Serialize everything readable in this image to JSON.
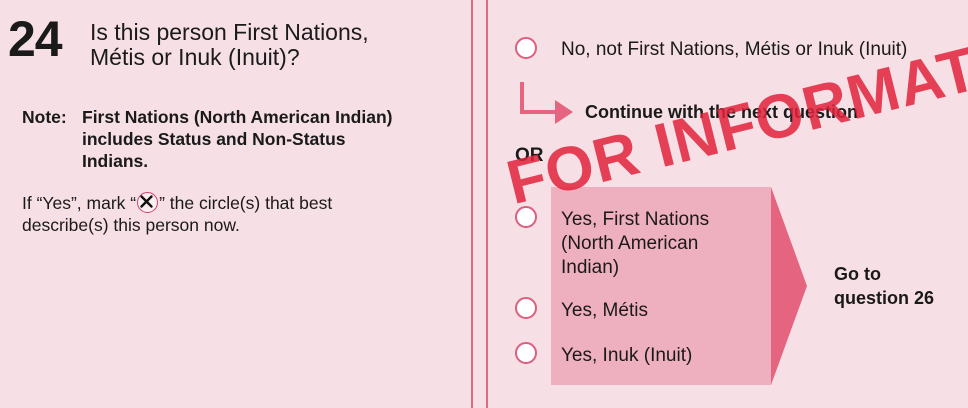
{
  "question": {
    "number": "24",
    "text": "Is this person First Nations,\nMétis or Inuk (Inuit)?",
    "note_label": "Note:",
    "note_text": "First Nations (North American Indian)\nincludes Status and Non-Status\nIndians.",
    "instruction_before": "If “Yes”, mark “",
    "instruction_after": "” the circle(s) that best",
    "instruction_line2": "describe(s) this person now."
  },
  "options": {
    "no": "No, not First Nations, Métis or Inuk (Inuit)",
    "continue_text": "Continue with the next question",
    "or_label": "OR",
    "yes_first_nations_l1": "Yes, First Nations",
    "yes_first_nations_l2": "(North American",
    "yes_first_nations_l3": "Indian)",
    "yes_metis": "Yes, Métis",
    "yes_inuk": "Yes, Inuk (Inuit)",
    "goto_text": "Go to\nquestion 26"
  },
  "stamp": "FOR INFORMATION",
  "colors": {
    "background": "#f6dfe5",
    "accent": "#e06a85",
    "shaded_box": "#eeb0be",
    "stamp": "#e2233c"
  },
  "icons": {
    "x_in_circle": "x-mark-icon",
    "continue_arrow": "continue-arrow-icon",
    "go_to_arrow": "goto-arrow-icon"
  }
}
